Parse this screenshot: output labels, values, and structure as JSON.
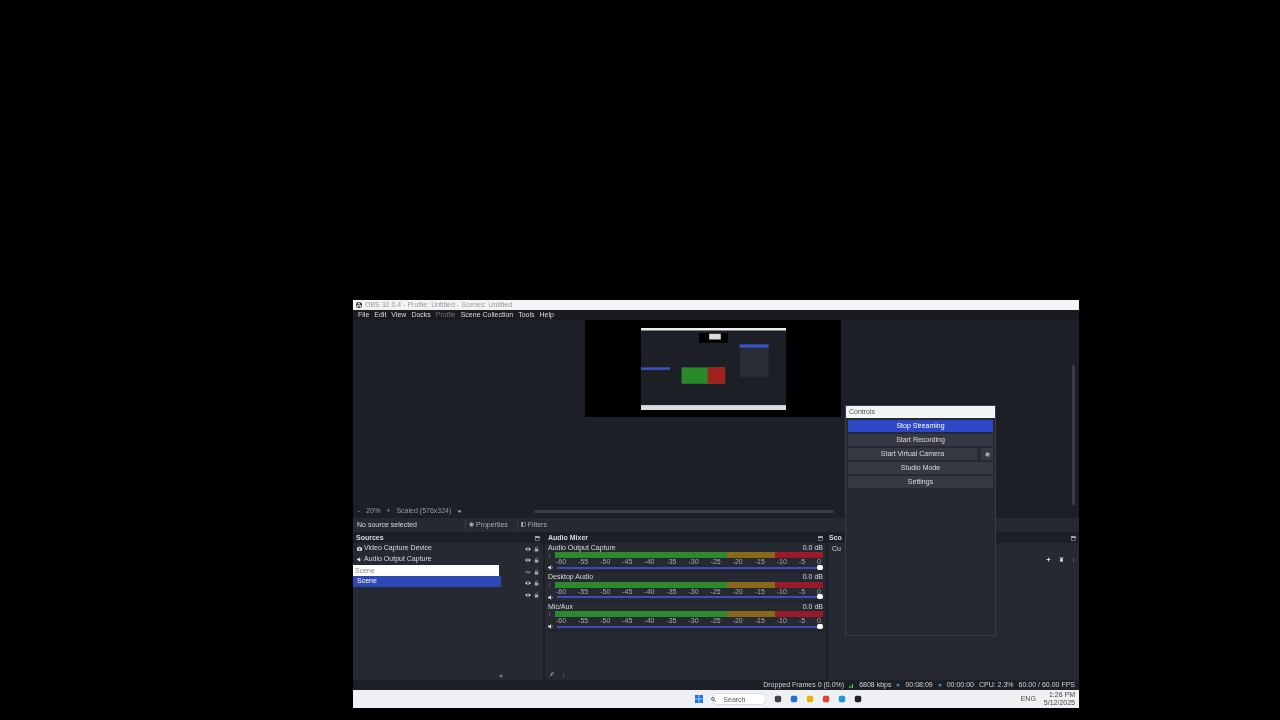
{
  "window": {
    "title": "OBS 32.0.4 - Profile: Untitled - Scenes: Untitled"
  },
  "menu": [
    {
      "label": "File",
      "disabled": false
    },
    {
      "label": "Edit",
      "disabled": false
    },
    {
      "label": "View",
      "disabled": false
    },
    {
      "label": "Docks",
      "disabled": false
    },
    {
      "label": "Profile",
      "disabled": true
    },
    {
      "label": "Scene Collection",
      "disabled": false
    },
    {
      "label": "Tools",
      "disabled": false
    },
    {
      "label": "Help",
      "disabled": false
    }
  ],
  "zoom_bar": {
    "minus": "-",
    "zoom": "20%",
    "plus": "+",
    "scale": "Scaled (576x324)"
  },
  "source_toolbar": {
    "status": "No source selected",
    "buttons": [
      "Properties",
      "Filters"
    ]
  },
  "sources": {
    "title": "Sources",
    "items": [
      {
        "kind": "camera",
        "label": "Video Capture Device",
        "selected": false
      },
      {
        "kind": "speaker",
        "label": "Audio Output Capture",
        "selected": false
      },
      {
        "kind": "rename",
        "label": "Scene",
        "selected": false
      },
      {
        "kind": "plain",
        "label": "Scene",
        "selected": true
      }
    ],
    "toggles": [
      {
        "visible": true
      },
      {
        "visible": true
      },
      {
        "visible": false
      },
      {
        "visible": true
      },
      {
        "visible": true
      }
    ]
  },
  "audio_mixer": {
    "title": "Audio Mixer",
    "channels": [
      {
        "name": "Audio Output Capture",
        "reading": "0.0 dB",
        "level": 1,
        "ticks": [
          "-60",
          "-55",
          "-50",
          "-45",
          "-40",
          "-35",
          "-30",
          "-25",
          "-20",
          "-15",
          "-10",
          "-5",
          "0"
        ]
      },
      {
        "name": "Desktop Audio",
        "reading": "0.0 dB",
        "level": 1,
        "ticks": [
          "-60",
          "-55",
          "-50",
          "-45",
          "-40",
          "-35",
          "-30",
          "-25",
          "-20",
          "-15",
          "-10",
          "-5",
          "0"
        ]
      },
      {
        "name": "Mic/Aux",
        "reading": "0.0 dB",
        "level": 1,
        "ticks": [
          "-60",
          "-55",
          "-50",
          "-45",
          "-40",
          "-35",
          "-30",
          "-25",
          "-20",
          "-15",
          "-10",
          "-5",
          "0"
        ]
      }
    ]
  },
  "transitions_dock": {
    "title": "Sco",
    "field": "Cu"
  },
  "controls": {
    "title": "Controls",
    "buttons": [
      {
        "kind": "plain",
        "label": "Stop Streaming",
        "selected": true
      },
      {
        "kind": "plain",
        "label": "Start Recording",
        "selected": false
      },
      {
        "kind": "with-gear",
        "label": "Start Virtual Camera",
        "selected": false
      },
      {
        "kind": "plain",
        "label": "Studio Mode",
        "selected": false
      },
      {
        "kind": "plain",
        "label": "Settings",
        "selected": false
      }
    ]
  },
  "status_bar": [
    "Dropped Frames 0 (0.0%)",
    "6808 kbps",
    "00:08:09",
    "00:00:00",
    "CPU: 2.3%",
    "60.00 / 60.00 FPS"
  ],
  "taskbar": {
    "placeholder": "Search",
    "language": "ENG",
    "time": "1:26 PM",
    "date": "5/12/2025"
  }
}
